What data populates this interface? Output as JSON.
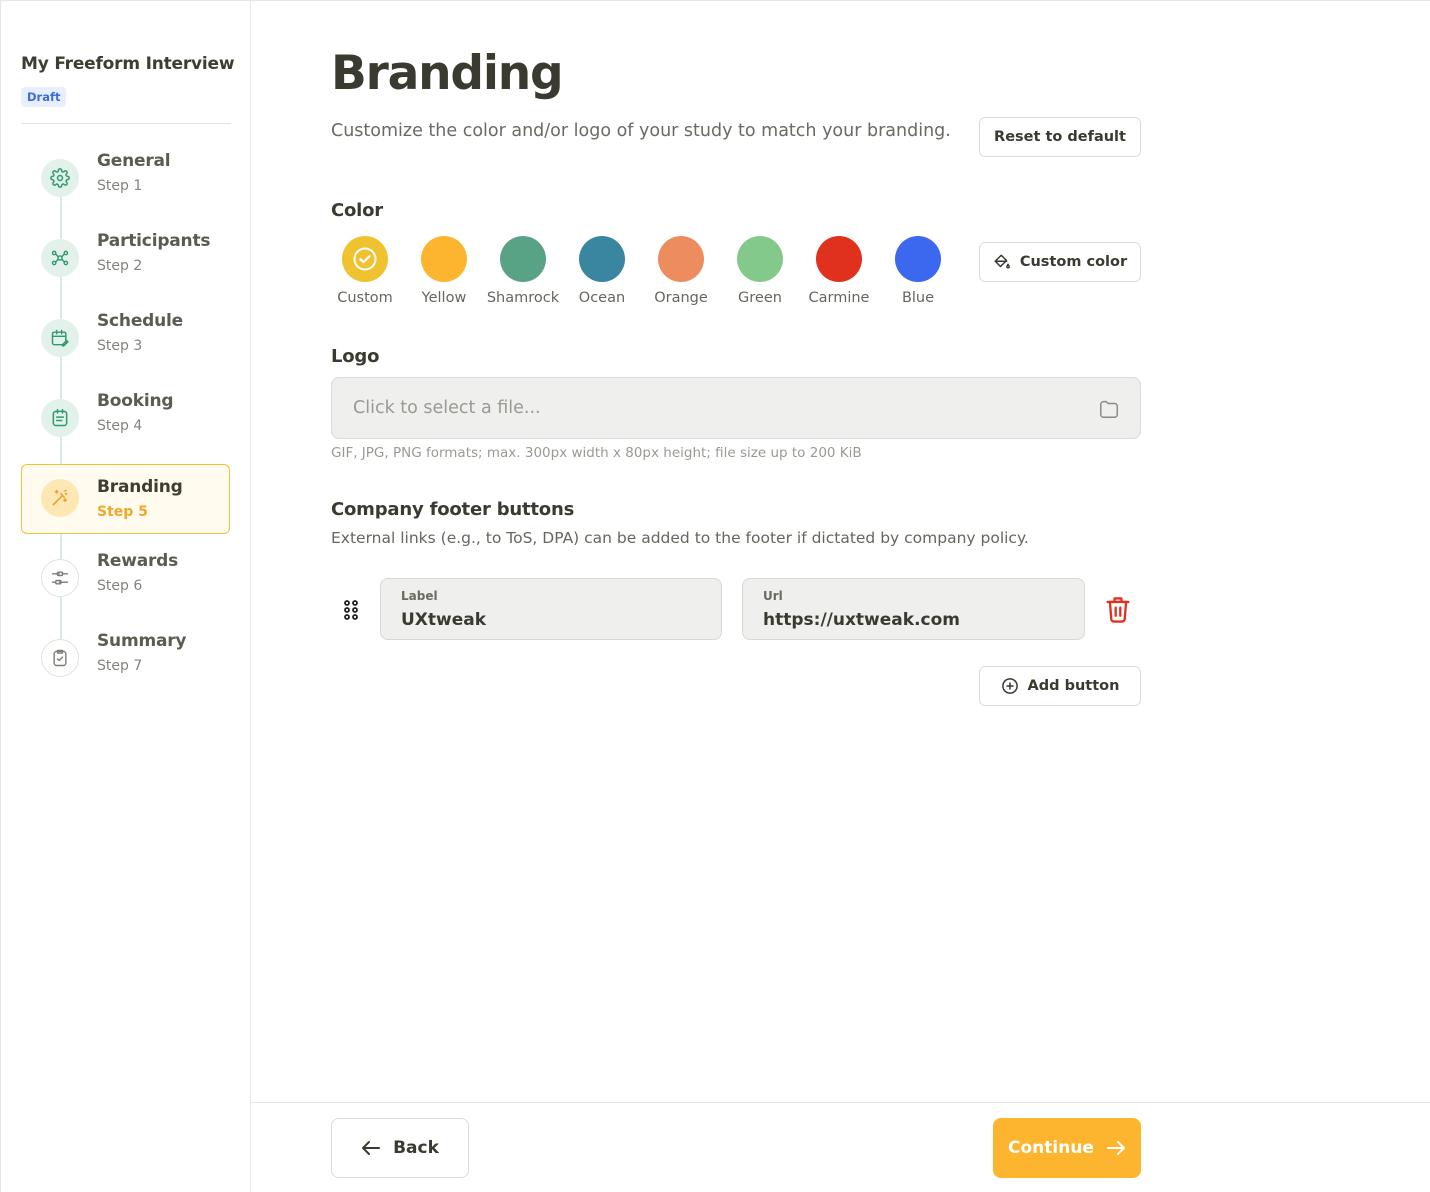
{
  "sidebar": {
    "study_title": "My Freeform Interview",
    "status_badge": "Draft",
    "steps": [
      {
        "name": "General",
        "sub": "Step 1",
        "icon": "gear-icon"
      },
      {
        "name": "Participants",
        "sub": "Step 2",
        "icon": "participants-icon"
      },
      {
        "name": "Schedule",
        "sub": "Step 3",
        "icon": "calendar-edit-icon"
      },
      {
        "name": "Booking",
        "sub": "Step 4",
        "icon": "booking-icon"
      },
      {
        "name": "Branding",
        "sub": "Step 5",
        "icon": "magic-wand-icon",
        "active": true
      },
      {
        "name": "Rewards",
        "sub": "Step 6",
        "icon": "sliders-icon"
      },
      {
        "name": "Summary",
        "sub": "Step 7",
        "icon": "clipboard-check-icon"
      }
    ]
  },
  "main": {
    "title": "Branding",
    "description": "Customize the color and/or logo of your study to match your branding.",
    "reset_label": "Reset to default",
    "color": {
      "heading": "Color",
      "custom_color_label": "Custom color",
      "swatches": [
        {
          "name": "Custom",
          "hex": "#f0c22f",
          "selected": true
        },
        {
          "name": "Yellow",
          "hex": "#fdb42e"
        },
        {
          "name": "Shamrock",
          "hex": "#58a285"
        },
        {
          "name": "Ocean",
          "hex": "#3a86a0"
        },
        {
          "name": "Orange",
          "hex": "#ed8c5e"
        },
        {
          "name": "Green",
          "hex": "#84c98c"
        },
        {
          "name": "Carmine",
          "hex": "#e0301e"
        },
        {
          "name": "Blue",
          "hex": "#3b68ee"
        }
      ]
    },
    "logo": {
      "heading": "Logo",
      "placeholder": "Click to select a file...",
      "hint": "GIF, JPG, PNG formats; max. 300px width x 80px height; file size up to 200 KiB"
    },
    "footer": {
      "heading": "Company footer buttons",
      "description": "External links (e.g., to ToS, DPA) can be added to the footer if dictated by company policy.",
      "rows": [
        {
          "label_title": "Label",
          "label_value": "UXtweak",
          "url_title": "Url",
          "url_value": "https://uxtweak.com"
        }
      ],
      "add_label": "Add button"
    }
  },
  "nav": {
    "back_label": "Back",
    "continue_label": "Continue"
  },
  "colors": {
    "accent": "#fdb42e",
    "step_green": "#3aa776",
    "danger": "#e0301e"
  }
}
